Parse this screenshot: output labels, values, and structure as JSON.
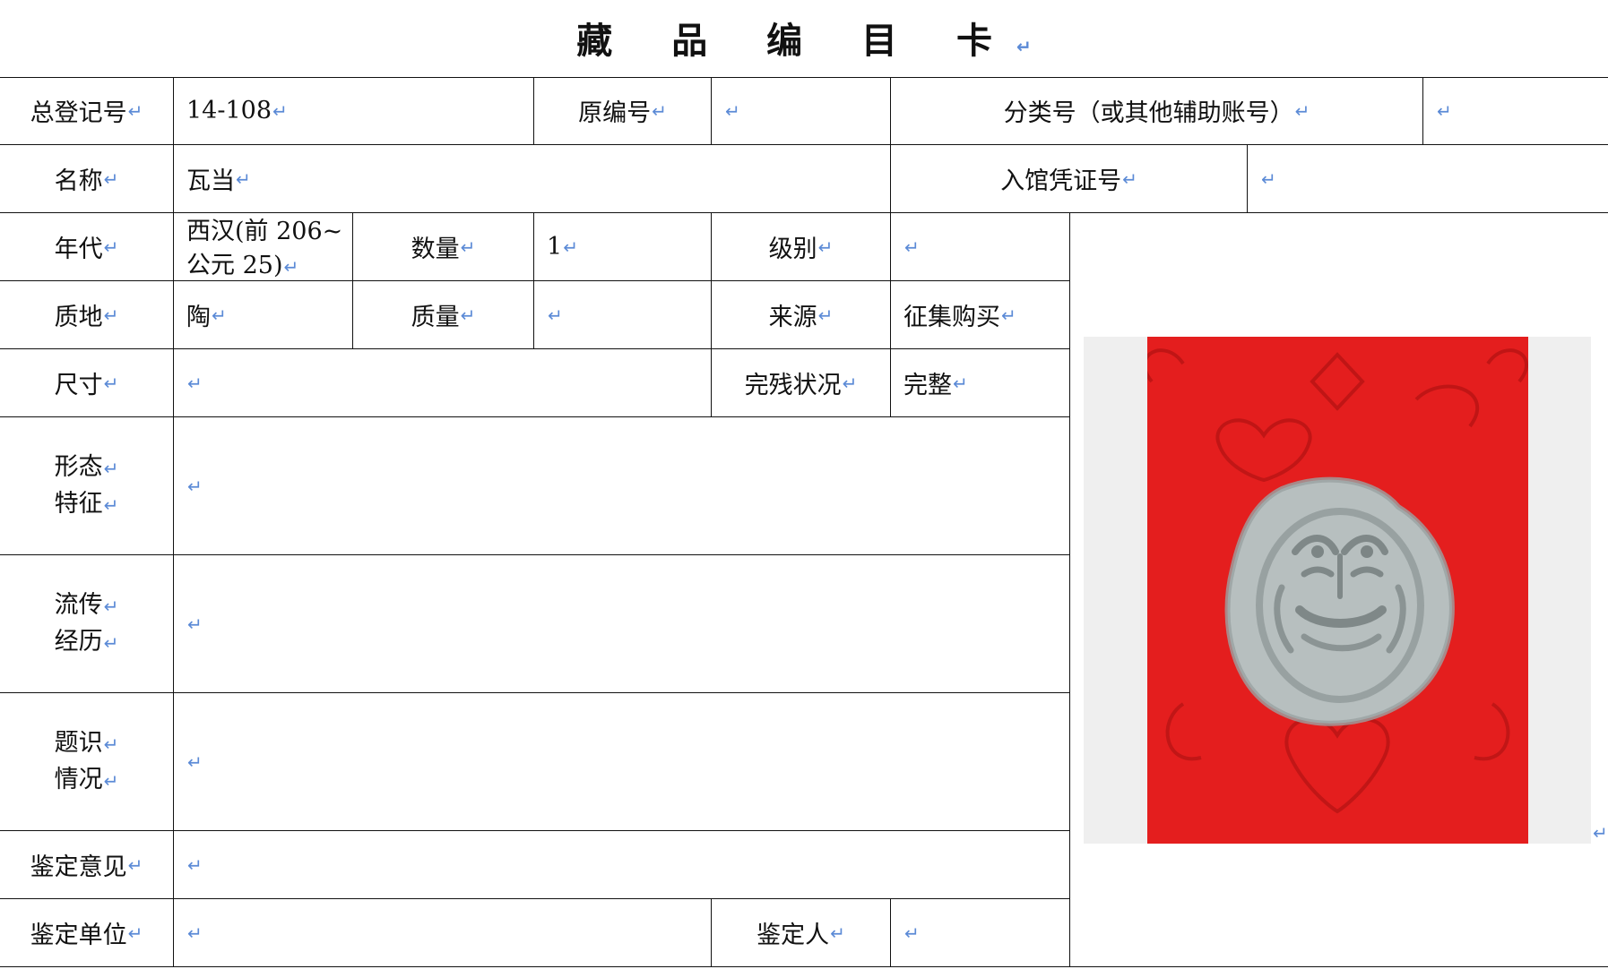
{
  "card": {
    "title": "藏 品 编 目 卡",
    "ret": "↵",
    "fields": {
      "registration_no_label": "总登记号",
      "registration_no_value": "14-108",
      "original_no_label": "原编号",
      "original_no_value": "",
      "classification_no_label": "分类号（或其他辅助账号）",
      "classification_no_value": "",
      "name_label": "名称",
      "name_value": "瓦当",
      "voucher_no_label": "入馆凭证号",
      "voucher_no_value": "",
      "age_label": "年代",
      "age_value_line1": "西汉(前 206~",
      "age_value_line2": "公元 25)",
      "quantity_label": "数量",
      "quantity_value": "1",
      "grade_label": "级别",
      "grade_value": "",
      "material_label": "质地",
      "material_value": "陶",
      "weight_label": "质量",
      "weight_value": "",
      "source_label": "来源",
      "source_value": "征集购买",
      "size_label": "尺寸",
      "size_value": "",
      "condition_label": "完残状况",
      "condition_value": "完整",
      "form_label_line1": "形态",
      "form_label_line2": "特征",
      "form_value": "",
      "provenance_label_line1": "流传",
      "provenance_label_line2": "经历",
      "provenance_value": "",
      "inscription_label_line1": "题识",
      "inscription_label_line2": "情况",
      "inscription_value": "",
      "appraisal_opinion_label": "鉴定意见",
      "appraisal_opinion_value": "",
      "appraisal_unit_label": "鉴定单位",
      "appraisal_unit_value": "",
      "appraiser_label": "鉴定人",
      "appraiser_value": ""
    },
    "photo": {
      "background_color": "#e41e1e",
      "tile_color": "#b7bfbf"
    }
  }
}
